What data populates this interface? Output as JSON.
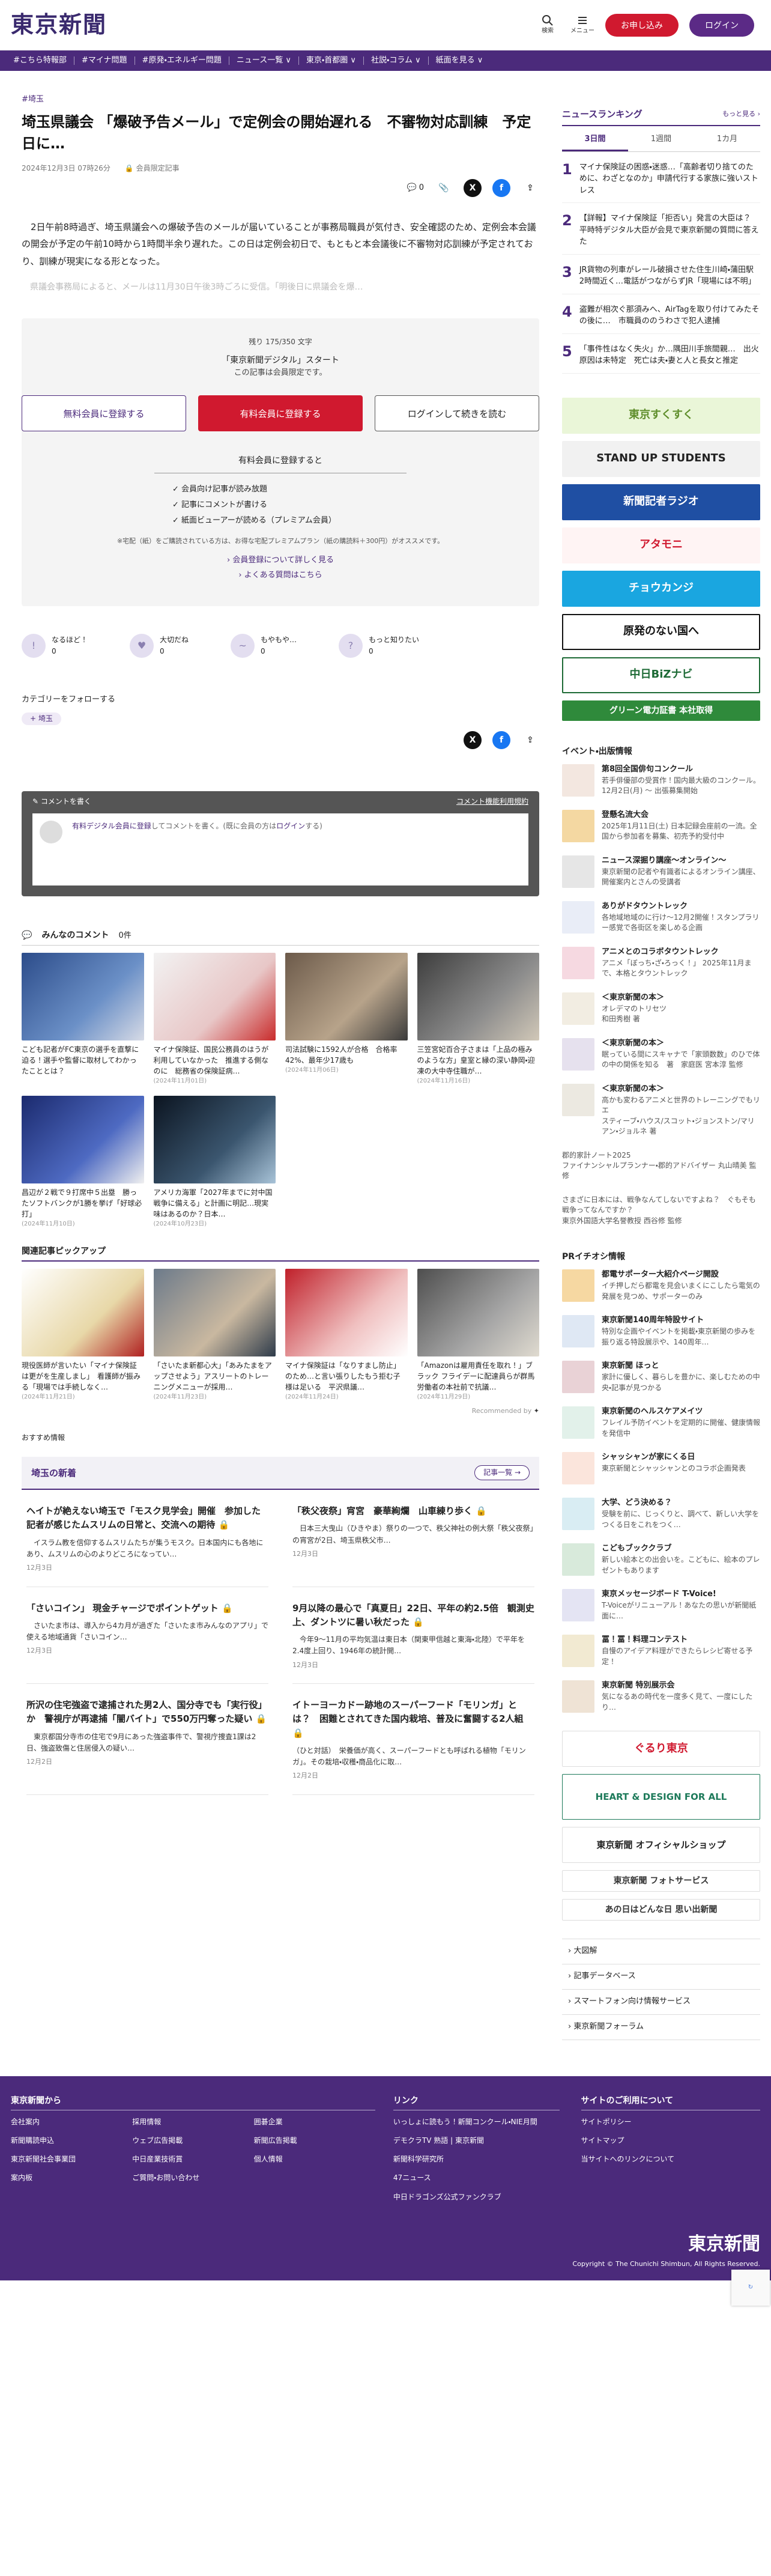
{
  "header": {
    "logo": "東京新聞",
    "search_label": "検索",
    "menu_label": "メニュー",
    "register_label": "お申し込み",
    "login_label": "ログイン"
  },
  "nav": [
    "#こちら特報部",
    "#マイナ問題",
    "#原発・エネルギー問題",
    "ニュース一覧 ∨",
    "東京・首都圏 ∨",
    "社説・コラム ∨",
    "紙面を見る ∨"
  ],
  "article": {
    "tag": "#埼玉",
    "title": "埼玉県議会 「爆破予告メール」で定例会の開始遅れる　不審物対応訓練　予定日に…",
    "date": "2024年12月3日 07時26分",
    "member_badge": "会員限定記事",
    "comment_count": "0",
    "body": "　2日午前8時過ぎ、埼玉県議会への爆破予告のメールが届いていることが事務局職員が気付き、安全確認のため、定例会本会議の開会が予定の午前10時から1時間半余り遅れた。この日は定例会初日で、もともと本会議後に不審物対応訓練が予定されており、訓練が現実になる形となった。",
    "body_fade": "　県議会事務局によると、メールは11月30日午後3時ごろに受信。「明後日に県議会を爆…"
  },
  "paywall": {
    "remaining": "残り 175/350 文字",
    "title": "「東京新聞デジタル」スタート",
    "subtitle": "この記事は会員限定です。",
    "btn_free": "無料会員に登録する",
    "btn_paid": "有料会員に登録する",
    "btn_login": "ログインして続きを読む",
    "benefit_title": "有料会員に登録すると",
    "benefits": [
      "会員向け記事が読み放題",
      "記事にコメントが書ける",
      "紙面ビューアーが読める（プレミアム会員）"
    ],
    "note": "※宅配（紙）をご購読されている方は、お得な宅配プレミアムプラン（紙の購読料＋300円）がオススメです。",
    "link_detail": "会員登録について詳しく見る",
    "link_faq": "よくある質問はこちら"
  },
  "reactions": [
    "なるほど！",
    "大切だね",
    "もやもや…",
    "もっと知りたい"
  ],
  "reaction_counts": [
    "0",
    "0",
    "0",
    "0"
  ],
  "follow": {
    "title": "カテゴリーをフォローする",
    "tag": "埼玉"
  },
  "comment": {
    "write": "コメントを書く",
    "rules": "コメント機能利用規約",
    "placeholder_pre": "有料デジタル会員に登録",
    "placeholder_mid": "してコメントを書く。(既に会員の方は",
    "placeholder_login": "ログイン",
    "placeholder_post": "する)"
  },
  "everyone_comments": {
    "title": "みんなのコメント",
    "count": "0件"
  },
  "related_cards": [
    {
      "caption": "こども記者がFC東京の選手を直撃に迫る！選手や監督に取材してわかったこととは？",
      "date": ""
    },
    {
      "caption": "マイナ保険証、国民公務員のはうが利用していなかった　推進する側なのに　総務省の保険証病…",
      "date": "(2024年11月01日)"
    },
    {
      "caption": "司法試験に1592人が合格　合格率42%、最年少17歳も",
      "date": "(2024年11月06日)"
    },
    {
      "caption": "三笠宮妃百合子さまは「上品の極みのような方」皇室と縁の深い静岡・迎凍の大中寺住職が…",
      "date": "(2024年11月16日)"
    },
    {
      "caption": "昌辺が２戦で９打席中５出塁　勝ったソフトバンクが1勝を挙げ「好球必打」",
      "date": "(2024年11月10日)"
    },
    {
      "caption": "アメリカ海軍「2027年までに対中国戦争に備える」と計画に明記…現実味はあるのか？日本…",
      "date": "(2024年10月23日)"
    }
  ],
  "pickup": {
    "title": "関連記事ピックアップ",
    "cards": [
      {
        "caption": "現役医師が言いたい「マイナ保険証は更がを生産しまし」　看護師が振みる「現場では手続しなく…",
        "date": "(2024年11月21日)"
      },
      {
        "caption": "「さいたま新都心大」「あみたまをアップさせよう」アスリートのトレーニングメニューが採用…",
        "date": "(2024年11月23日)"
      },
      {
        "caption": "マイナ保険証は「なりすまし防止」のため…と言い張りしたもう拒む子様は足いる　平沢県議…",
        "date": "(2024年11月24日)"
      },
      {
        "caption": "「Amazonは雇用責任を取れ！」ブラック フライデーに配達員らが群馬労働者の本社前で抗議…",
        "date": "(2024年11月29日)"
      }
    ],
    "recommended_by": "Recommended by"
  },
  "osusume": "おすすめ情報",
  "saitama_news": {
    "title": "埼玉の新着",
    "more": "記事一覧",
    "items": [
      {
        "title": "ヘイトが絶えない埼玉で「モスク見学会」開催　参加した記者が感じたムスリムの日常と、交流への期待",
        "lock": true,
        "text": "　イスラム教を信仰するムスリムたちが集うモスク。日本国内にも各地にあり、ムスリムの心のよりどころになってい…",
        "date": "12月3日"
      },
      {
        "title": "「秩父夜祭」宵宮　豪華絢爛　山車練り歩く",
        "lock": true,
        "text": "　日本三大曳山（ひきやま）祭りの一つで、秩父神社の例大祭「秩父夜祭」の宵宮が2日、埼玉県秩父市…",
        "date": "12月3日"
      },
      {
        "title": "「さいコイン」 現金チャージでポイントゲット",
        "lock": true,
        "text": "　さいたま市は、導入から4カ月が過ぎた「さいたま市みんなのアプリ」で使える地域通貨「さいコイン…",
        "date": "12月3日"
      },
      {
        "title": "9月以降の最心で「真夏日」22日、平年の約2.5倍　観測史上、ダントツに暑い秋だった",
        "lock": true,
        "text": "　今年9〜11月の平均気温は東日本（関東甲信越と東海・北陸）で平年を2.4度上回り、1946年の統計開…",
        "date": "12月3日"
      },
      {
        "title": "所沢の住宅強盗で逮捕された男2人、国分寺でも「実行役」か　警視庁が再逮捕「闇バイト」で550万円奪った疑い",
        "lock": true,
        "text": "　東京都国分寺市の住宅で9月にあった強盗事件で、警視庁捜査1課は2日、強盗致傷と住居侵入の疑い…",
        "date": "12月2日"
      },
      {
        "title": "イトーヨーカドー跡地のスーパーフード「モリンガ」とは？　困難とされてきた国内栽培、普及に奮闘する2人組",
        "lock": true,
        "text": "（ひと対話）　栄養価が高く、スーパーフードとも呼ばれる植物「モリンガ」。その栽培・収穫・商品化に取…",
        "date": "12月2日"
      }
    ]
  },
  "ranking": {
    "title": "ニュースランキング",
    "more": "もっと見る",
    "tabs": [
      "3日間",
      "1週間",
      "1カ月"
    ],
    "items": [
      "マイナ保険証の困惑・迷惑…「高齢者切り捨てのために、わざとなのか」申請代行する家族に強いストレス",
      "【詳報】マイナ保険証「拒否い」発言の大臣は？　平時特デジタル大臣が会見で東京新聞の質問に答えた",
      "JR貨物の列車がレール破損させた住生川崎・蒲田駅　2時間近く…電話がつながらずJR「現場には不明」",
      "盗難が相次ぐ那須みへ、AirTagを取り付けてみたその後に…　市職員ののうわさで犯人逮捕",
      "「事件性はなく失火」か…隅田川手旅間親…　出火原因は未特定　死亡は夫・妻と人と長女と推定"
    ]
  },
  "banners": [
    {
      "text": "東京すくすく",
      "bg": "#eaf6d8",
      "fg": "#5e8d2a"
    },
    {
      "text": "STAND UP STUDENTS",
      "bg": "#f1f1f1",
      "fg": "#222"
    },
    {
      "text": "新聞記者ラジオ",
      "bg": "#1f4fa3",
      "fg": "#ffffff"
    },
    {
      "text": "アタモニ",
      "bg": "#fff4f4",
      "fg": "#d0192f"
    },
    {
      "text": "チョウカンジ",
      "bg": "#1aa6e0",
      "fg": "#ffffff"
    },
    {
      "text": "原発のない国へ",
      "bg": "#ffffff",
      "fg": "#111111"
    },
    {
      "text": "中日BiZナビ",
      "bg": "#ffffff",
      "fg": "#1d6a35"
    },
    {
      "text": "グリーン電力証書 本社取得",
      "bg": "#2f8a3b",
      "fg": "#ffffff"
    }
  ],
  "events": {
    "title": "イベント・出版情報",
    "items": [
      {
        "title": "第8回全国俳句コンクール",
        "text": "若手俳優部の受賞作！国内最大級のコンクール。12月2日(月) 〜 出張募集開始",
        "bg": "#f3e7e0"
      },
      {
        "title": "登懸名流大会",
        "text": "2025年1月11日(土) 日本記録会座前の一流。全国から参加者を募集、初売予約受付中",
        "bg": "#f4d8a2"
      },
      {
        "title": "ニュース深掘り講座〜オンライン〜",
        "text": "東京新聞の記者や有識者によるオンライン講座、開催案内とさんの受講者",
        "bg": "#e6e6e6"
      },
      {
        "title": "ありがドタウントレック",
        "text": "各地域地域のに行け〜12月2開催！スタンプラリー感覚で各街区を楽しめる企画",
        "bg": "#e9edf7"
      },
      {
        "title": "アニメとのコラボタウントレック",
        "text": "アニメ「ぼっち・ざ・ろっく！」 2025年11月まで、本格とタウントレック",
        "bg": "#f6d9e1"
      },
      {
        "title": "＜東京新聞の本＞",
        "text": "オレデマのトリセツ\n和田秀樹 著",
        "bg": "#f2ede2"
      },
      {
        "title": "＜東京新聞の本＞",
        "text": "眠っている間にスキャナで「家頭数数」のひで体の中の関係を知る　著　家庭医 宮本淳 監修",
        "bg": "#e6e1ee"
      },
      {
        "title": "＜東京新聞の本＞",
        "text": "高かも変わるアニメと世界のトレーニングでもリエ\nスティーブ・ハウス/スコット・ジョンストン/マリアン・ジョルネ 著",
        "bg": "#ece9e1"
      },
      {
        "title": "",
        "text": "郡的家計ノート2025\nファイナンシャルプランナー・郡的アドバイザー 丸山晴美 監修",
        "bg": "#ffffff"
      },
      {
        "title": "",
        "text": "さまざに日本には、戦争なんてしないですよね？　ぐもそも戦争ってなんですか？\n東京外国語大学名誉教授 西谷修 監修",
        "bg": "#ffffff"
      }
    ]
  },
  "pr": {
    "title": "PRイチオシ情報",
    "items": [
      {
        "title": "都電サポーター大紹介ページ開設",
        "text": "イチ押しだら都電を見会いまくにこしたら電気の発展を見つめ、サポーターのみ",
        "bg": "#f6d8a2"
      },
      {
        "title": "東京新聞140周年特設サイト",
        "text": "特別な企画やイベントを掲載・東京新聞の歩みを振り返る特設展示や、140周年…",
        "bg": "#dfe8f4"
      },
      {
        "title": "東京新聞 ほっと",
        "text": "家計に優しく、暮らしを豊かに、楽しむための中央・記事が見つかる",
        "bg": "#e9d2d6"
      },
      {
        "title": "東京新聞のヘルスケアメイツ",
        "text": "フレイル予防イベントを定期的に開催、健康情報を発信中",
        "bg": "#e2f1ea"
      },
      {
        "title": "シャッシャンが家にくる日",
        "text": "東京新聞とシャッシャンとのコラボ企画発表",
        "bg": "#fbe5dc"
      },
      {
        "title": "大学、どう決める？",
        "text": "受験を前に、じっくりと、調べて、新しい大学をつくる日をこれをつく…",
        "bg": "#d9edf3"
      },
      {
        "title": "こどもブッククラブ",
        "text": "新しい絵本との出会いを。こどもに、絵本のプレゼントもあります",
        "bg": "#d8eadb"
      },
      {
        "title": "東京メッセージボード T-Voice!",
        "text": "T-Voiceがリニューアル！あなたの思いが新聞紙面に…",
        "bg": "#e4e4f3"
      },
      {
        "title": "冨！冨！料理コンテスト",
        "text": "自慢のアイデア料理ができたらレシピ寄せる予定！",
        "bg": "#f2ead2"
      },
      {
        "title": "東京新聞 特別展示会",
        "text": "気になるあの時代を一度多く見て、一度にしたり…",
        "bg": "#efe3d5"
      }
    ]
  },
  "side_banners2": [
    {
      "text": "ぐるり東京",
      "bg": "#ffffff",
      "fg": "#d0192f"
    },
    {
      "text": "HEART & DESIGN FOR ALL",
      "bg": "#ffffff",
      "fg": "#1d7a5a"
    },
    {
      "text": "東京新聞 オフィシャルショップ",
      "bg": "#ffffff",
      "fg": "#222222"
    },
    {
      "text": "東京新聞 フォトサービス",
      "bg": "#ffffff",
      "fg": "#333333"
    },
    {
      "text": "あの日はどんな日 思い出新聞",
      "bg": "#ffffff",
      "fg": "#333333"
    }
  ],
  "side_links": [
    "大図解",
    "記事データベース",
    "スマートフォン向け情報サービス",
    "東京新聞フォーラム"
  ],
  "footer": {
    "col1_title": "東京新聞から",
    "col1_links": [
      "会社案内",
      "採用情報",
      "囲碁企業",
      "新聞購読申込",
      "ウェブ広告掲載",
      "新聞広告掲載",
      "東京新聞社会事業団",
      "中日産業技術賞",
      "個人情報",
      "案内板",
      "ご質問・お問い合わせ",
      ""
    ],
    "col2_title": "リンク",
    "col2_links": [
      "いっしょに読もう！新聞コンクール・NIE月間",
      "デモクラTV 熟語 | 東京新聞",
      "新聞科学研究所",
      "47ニュース",
      "中日ドラゴンズ公式ファンクラブ"
    ],
    "col3_title": "サイトのご利用について",
    "col3_links": [
      "サイトポリシー",
      "サイトマップ",
      "当サイトへのリンクについて"
    ],
    "logo": "東京新聞",
    "copyright": "Copyright © The Chunichi Shimbun, All Rights Reserved."
  },
  "colors": {
    "brand": "#4b2a7b",
    "accent": "#d0192f"
  }
}
